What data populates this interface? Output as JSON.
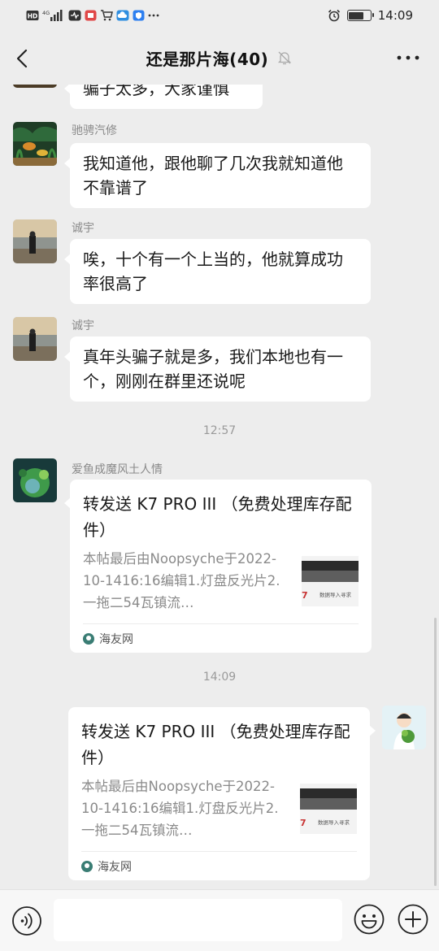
{
  "status_bar": {
    "left_indicators": "HD 4G",
    "time": "14:09",
    "battery_level": 0.75,
    "icons": [
      "hd-icon",
      "signal-icon",
      "health-icon",
      "red-app-icon",
      "cart-icon",
      "cloud-icon",
      "shield-icon",
      "more-dots-icon",
      "alarm-icon",
      "battery-icon"
    ]
  },
  "nav": {
    "title": "还是那片海(40)",
    "icons": [
      "back-chevron-icon",
      "mute-bell-icon",
      "more-icon"
    ]
  },
  "messages": [
    {
      "sender": "",
      "text": "骗子太多，大家谨慎"
    },
    {
      "sender": "驰骋汽修",
      "text": "我知道他，跟他聊了几次我就知道他不靠谱了"
    },
    {
      "sender": "诚宇",
      "text": "唉，十个有一个上当的，他就算成功率很高了"
    },
    {
      "sender": "诚宇",
      "text": "真年头骗子就是多，我们本地也有一个，刚刚在群里还说呢"
    }
  ],
  "timestamps": [
    "12:57",
    "14:09"
  ],
  "cards": [
    {
      "sender": "爱鱼成魔风土人情",
      "title": "转发送 K7 PRO III （免费处理库存配件）",
      "desc": "本帖最后由Noopsyche于2022-10-1416:16编辑1.灯盘反光片2.一拖二54瓦镇流…",
      "thumb_text": "数据导入寻求",
      "source": "海友网"
    },
    {
      "sender": "",
      "title": "转发送 K7 PRO III （免费处理库存配件）",
      "desc": "本帖最后由Noopsyche于2022-10-1416:16编辑1.灯盘反光片2.一拖二54瓦镇流…",
      "thumb_text": "数据导入寻求",
      "source": "海友网"
    }
  ],
  "input_bar": {
    "placeholder": "",
    "icons": [
      "voice-icon",
      "emoji-icon",
      "plus-icon"
    ]
  },
  "colors": {
    "background": "#ededed",
    "bubble": "#ffffff",
    "muted_text": "#8a8a8a"
  }
}
